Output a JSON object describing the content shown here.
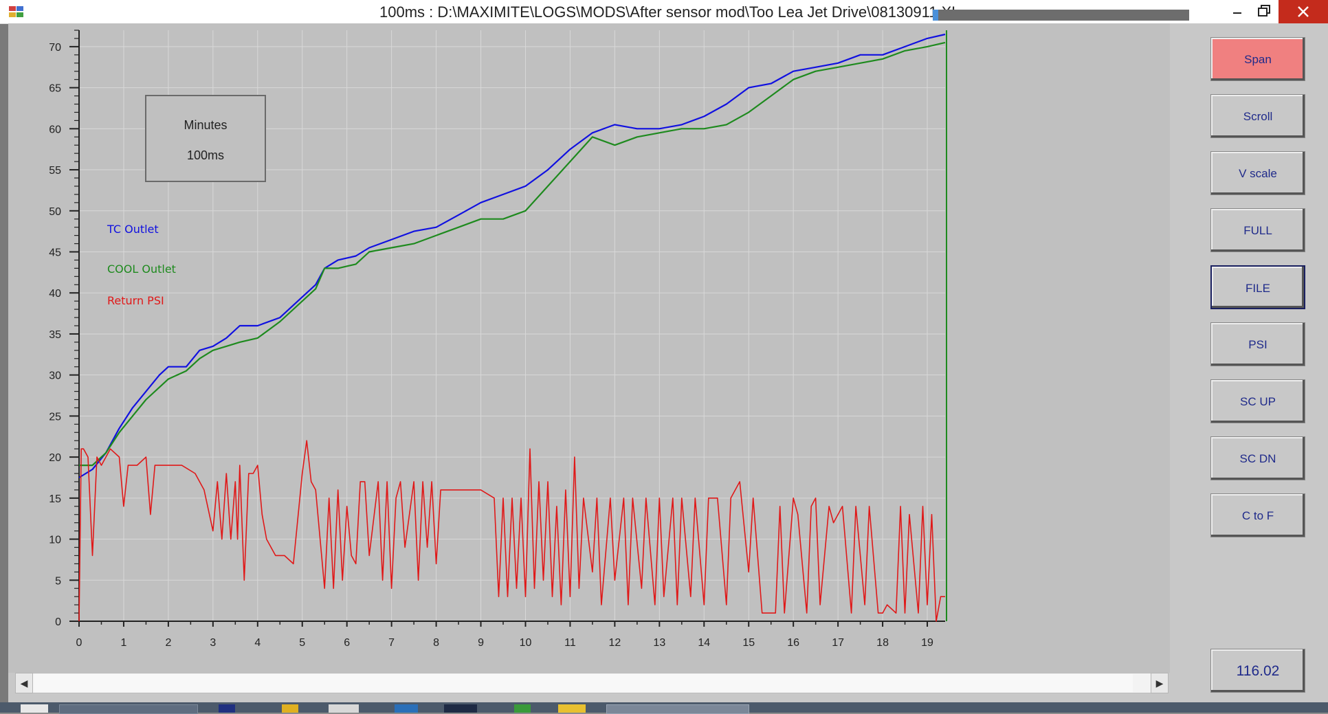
{
  "window": {
    "title": "100ms : D:\\MAXIMITE\\LOGS\\MODS\\After sensor mod\\Too Lea Jet Drive\\08130911.XLS"
  },
  "units_box": {
    "time_unit": "Minutes",
    "interval": "100ms"
  },
  "buttons": [
    {
      "label": "Span",
      "state": "active"
    },
    {
      "label": "Scroll",
      "state": "normal"
    },
    {
      "label": "V scale",
      "state": "normal"
    },
    {
      "label": "FULL",
      "state": "normal"
    },
    {
      "label": "FILE",
      "state": "selected"
    },
    {
      "label": "PSI",
      "state": "normal"
    },
    {
      "label": "SC UP",
      "state": "normal"
    },
    {
      "label": "SC DN",
      "state": "normal"
    },
    {
      "label": "C to F",
      "state": "normal"
    }
  ],
  "readout": "116.02",
  "colors": {
    "tc": "#1010e0",
    "cool": "#1e8a1e",
    "psi": "#e01818",
    "active_button": "#f08080",
    "plot_bg": "#c0c0c0"
  },
  "chart_data": {
    "type": "line",
    "xlim": [
      0,
      19.4
    ],
    "ylim": [
      0,
      72
    ],
    "x_ticks": [
      0,
      1,
      2,
      3,
      4,
      5,
      6,
      7,
      8,
      9,
      10,
      11,
      12,
      13,
      14,
      15,
      16,
      17,
      18,
      19
    ],
    "y_ticks": [
      0,
      5,
      10,
      15,
      20,
      25,
      30,
      35,
      40,
      45,
      50,
      55,
      60,
      65,
      70
    ],
    "grid": true,
    "legend_position": "left",
    "series": [
      {
        "name": "TC Outlet",
        "color": "#1010e0",
        "x": [
          0.0,
          0.3,
          0.6,
          0.9,
          1.2,
          1.5,
          1.8,
          2.0,
          2.4,
          2.7,
          3.0,
          3.3,
          3.6,
          4.0,
          4.5,
          5.0,
          5.3,
          5.5,
          5.8,
          6.2,
          6.5,
          7.0,
          7.5,
          8.0,
          8.5,
          9.0,
          9.5,
          10.0,
          10.5,
          11.0,
          11.5,
          12.0,
          12.5,
          13.0,
          13.5,
          14.0,
          14.5,
          15.0,
          15.5,
          16.0,
          16.5,
          17.0,
          17.5,
          18.0,
          18.5,
          19.0,
          19.4
        ],
        "y": [
          17.5,
          18.5,
          20.5,
          23.5,
          26,
          28,
          30,
          31,
          31,
          33,
          33.5,
          34.5,
          36,
          36,
          37,
          39.5,
          41,
          43,
          44,
          44.5,
          45.5,
          46.5,
          47.5,
          48,
          49.5,
          51,
          52,
          53,
          55,
          57.5,
          59.5,
          60.5,
          60,
          60,
          60.5,
          61.5,
          63,
          65,
          65.5,
          67,
          67.5,
          68,
          69,
          69,
          70,
          71,
          71.5
        ]
      },
      {
        "name": "COOL Outlet",
        "color": "#1e8a1e",
        "x": [
          0.0,
          0.3,
          0.6,
          0.9,
          1.2,
          1.5,
          1.8,
          2.0,
          2.4,
          2.7,
          3.0,
          3.3,
          3.6,
          4.0,
          4.5,
          5.0,
          5.3,
          5.5,
          5.8,
          6.2,
          6.5,
          7.0,
          7.5,
          8.0,
          8.5,
          9.0,
          9.5,
          10.0,
          10.5,
          11.0,
          11.5,
          12.0,
          12.5,
          13.0,
          13.5,
          14.0,
          14.5,
          15.0,
          15.5,
          16.0,
          16.5,
          17.0,
          17.5,
          18.0,
          18.5,
          19.0,
          19.4
        ],
        "y": [
          19,
          19,
          20.5,
          23,
          25,
          27,
          28.5,
          29.5,
          30.5,
          32,
          33,
          33.5,
          34,
          34.5,
          36.5,
          39,
          40.5,
          43,
          43,
          43.5,
          45,
          45.5,
          46,
          47,
          48,
          49,
          49,
          50,
          53,
          56,
          59,
          58,
          59,
          59.5,
          60,
          60,
          60.5,
          62,
          64,
          66,
          67,
          67.5,
          68,
          68.5,
          69.5,
          70,
          70.5
        ]
      },
      {
        "name": "Return PSI",
        "color": "#e01818",
        "x": [
          0.0,
          0.05,
          0.1,
          0.2,
          0.3,
          0.4,
          0.5,
          0.7,
          0.9,
          1.0,
          1.1,
          1.3,
          1.5,
          1.6,
          1.7,
          2.0,
          2.3,
          2.6,
          2.8,
          3.0,
          3.1,
          3.2,
          3.3,
          3.4,
          3.5,
          3.55,
          3.6,
          3.7,
          3.8,
          3.9,
          4.0,
          4.1,
          4.2,
          4.4,
          4.6,
          4.8,
          5.0,
          5.1,
          5.2,
          5.3,
          5.5,
          5.6,
          5.7,
          5.8,
          5.9,
          6.0,
          6.1,
          6.2,
          6.3,
          6.4,
          6.5,
          6.7,
          6.8,
          6.9,
          7.0,
          7.1,
          7.2,
          7.3,
          7.5,
          7.6,
          7.7,
          7.8,
          7.9,
          8.0,
          8.1,
          8.3,
          8.6,
          9.0,
          9.3,
          9.4,
          9.5,
          9.6,
          9.7,
          9.8,
          9.9,
          10.0,
          10.1,
          10.2,
          10.3,
          10.4,
          10.5,
          10.6,
          10.7,
          10.8,
          10.9,
          11.0,
          11.1,
          11.2,
          11.3,
          11.5,
          11.6,
          11.7,
          11.9,
          12.0,
          12.2,
          12.3,
          12.4,
          12.6,
          12.7,
          12.9,
          13.0,
          13.1,
          13.3,
          13.4,
          13.5,
          13.7,
          13.8,
          14.0,
          14.1,
          14.3,
          14.5,
          14.6,
          14.8,
          15.0,
          15.1,
          15.3,
          15.5,
          15.6,
          15.7,
          15.8,
          16.0,
          16.1,
          16.3,
          16.4,
          16.5,
          16.6,
          16.8,
          16.9,
          17.1,
          17.3,
          17.4,
          17.6,
          17.7,
          17.9,
          18.0,
          18.1,
          18.3,
          18.4,
          18.5,
          18.6,
          18.8,
          18.9,
          19.0,
          19.1,
          19.2,
          19.3,
          19.4
        ],
        "y": [
          0,
          21,
          21,
          20,
          8,
          20,
          19,
          21,
          20,
          14,
          19,
          19,
          20,
          13,
          19,
          19,
          19,
          18,
          16,
          11,
          17,
          10,
          18,
          10,
          17,
          10,
          19,
          5,
          18,
          18,
          19,
          13,
          10,
          8,
          8,
          7,
          18,
          22,
          17,
          16,
          4,
          15,
          4,
          16,
          5,
          14,
          8,
          7,
          17,
          17,
          8,
          17,
          5,
          17,
          4,
          15,
          17,
          9,
          17,
          5,
          17,
          9,
          17,
          7,
          16,
          16,
          16,
          16,
          15,
          3,
          15,
          3,
          15,
          4,
          15,
          3,
          21,
          4,
          17,
          5,
          17,
          3,
          14,
          2,
          16,
          3,
          20,
          4,
          15,
          6,
          15,
          2,
          15,
          5,
          15,
          2,
          15,
          4,
          15,
          2,
          15,
          3,
          15,
          2,
          15,
          3,
          15,
          2,
          15,
          15,
          2,
          15,
          17,
          6,
          15,
          1,
          1,
          1,
          14,
          1,
          15,
          13,
          1,
          14,
          15,
          2,
          14,
          12,
          14,
          1,
          14,
          2,
          14,
          1,
          1,
          2,
          1,
          14,
          1,
          13,
          1,
          14,
          2,
          13,
          0,
          3,
          3
        ]
      }
    ]
  }
}
